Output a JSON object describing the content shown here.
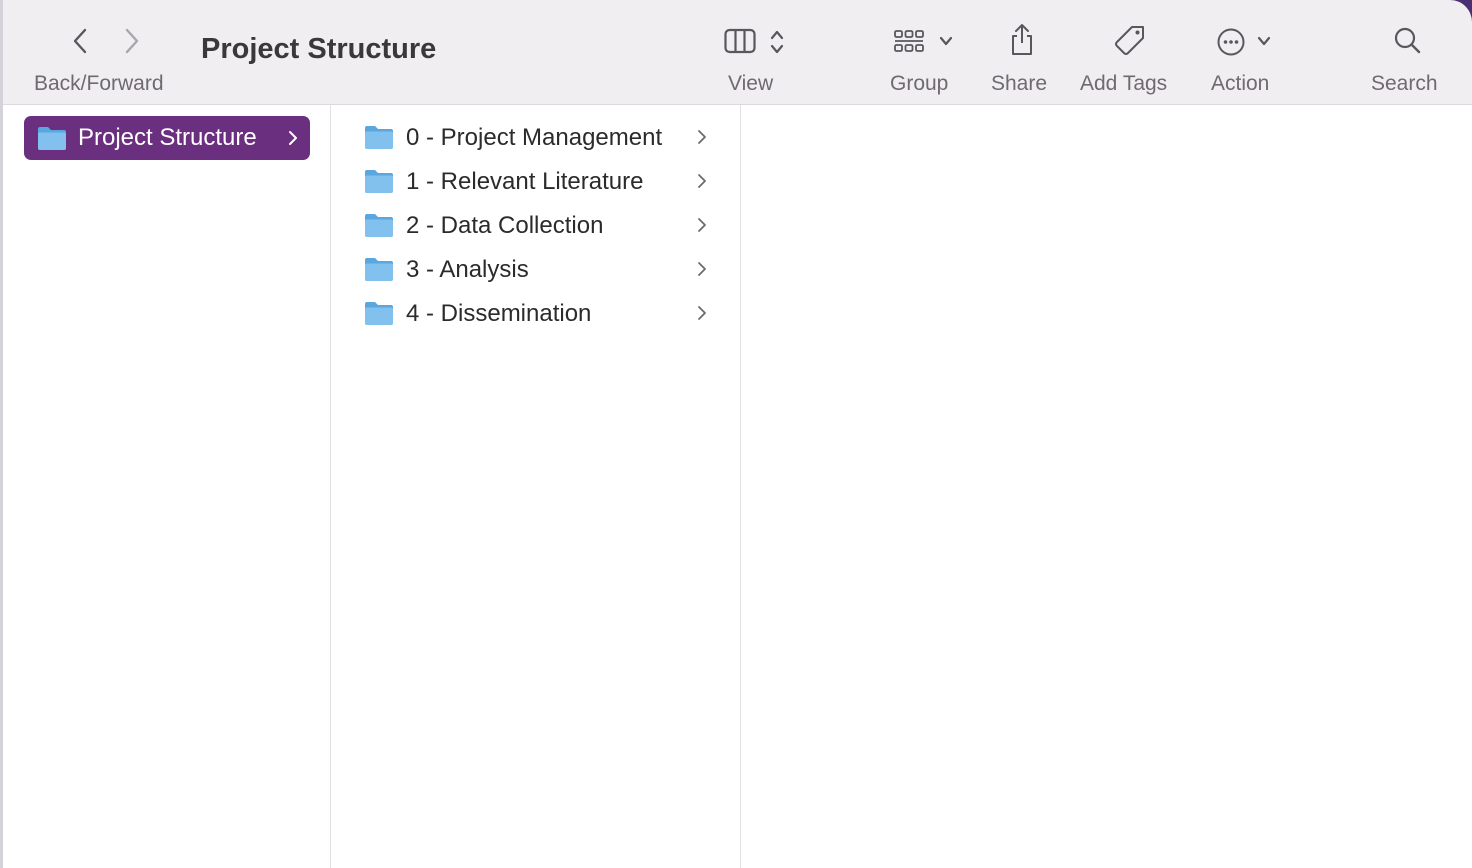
{
  "window": {
    "title": "Project Structure",
    "accent_color": "#6b2f7f",
    "toolbar_bg": "#f0eef1"
  },
  "toolbar": {
    "back_forward_label": "Back/Forward",
    "view_label": "View",
    "group_label": "Group",
    "share_label": "Share",
    "add_tags_label": "Add Tags",
    "action_label": "Action",
    "search_label": "Search"
  },
  "sidebar": {
    "selected_folder": "Project Structure"
  },
  "folders": [
    {
      "label": "0 - Project Management"
    },
    {
      "label": "1 - Relevant Literature"
    },
    {
      "label": "2 - Data Collection"
    },
    {
      "label": "3 - Analysis"
    },
    {
      "label": "4 - Dissemination"
    }
  ]
}
